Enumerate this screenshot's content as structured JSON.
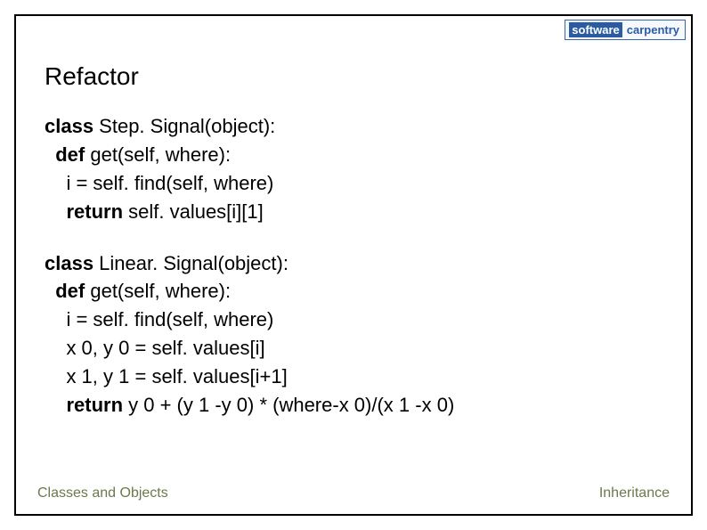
{
  "logo": {
    "word1": "software",
    "word2": "carpentry"
  },
  "title": "Refactor",
  "code": {
    "block1": {
      "l1a": "class",
      "l1b": " Step. Signal(object):",
      "l2a": "  def",
      "l2b": " get(self, where):",
      "l3": "    i = self. find(self, where)",
      "l4a": "    return",
      "l4b": " self. values[i][1]"
    },
    "block2": {
      "l1a": "class",
      "l1b": " Linear. Signal(object):",
      "l2a": "  def",
      "l2b": " get(self, where):",
      "l3": "    i = self. find(self, where)",
      "l4": "    x 0, y 0 = self. values[i]",
      "l5": "    x 1, y 1 = self. values[i+1]",
      "l6a": "    return",
      "l6b": " y 0 + (y 1 -y 0) * (where-x 0)/(x 1 -x 0)"
    }
  },
  "footer": {
    "left": "Classes and Objects",
    "right": "Inheritance"
  }
}
